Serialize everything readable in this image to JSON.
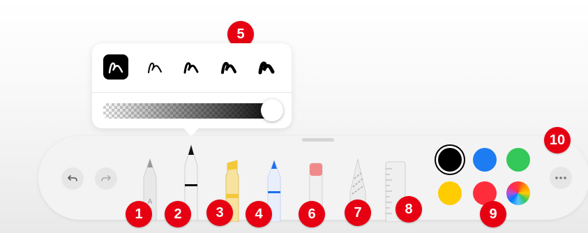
{
  "callouts": [
    "5",
    "1",
    "2",
    "3",
    "4",
    "6",
    "7",
    "8",
    "9",
    "10"
  ],
  "popover": {
    "stroke_widths": [
      "stroke-1",
      "stroke-2",
      "stroke-3",
      "stroke-4",
      "stroke-5"
    ],
    "selected_stroke": 0,
    "opacity": 1.0
  },
  "toolbar": {
    "undo_icon": "undo-icon",
    "redo_icon": "redo-icon",
    "tools": [
      "pen",
      "marker",
      "highlighter",
      "blue-pen",
      "eraser",
      "lasso",
      "ruler"
    ],
    "colors": [
      "#000000",
      "#1e7cf2",
      "#34c759",
      "#ffcc00",
      "#ff2d3c",
      "color-wheel"
    ],
    "more_icon": "ellipsis-icon"
  }
}
